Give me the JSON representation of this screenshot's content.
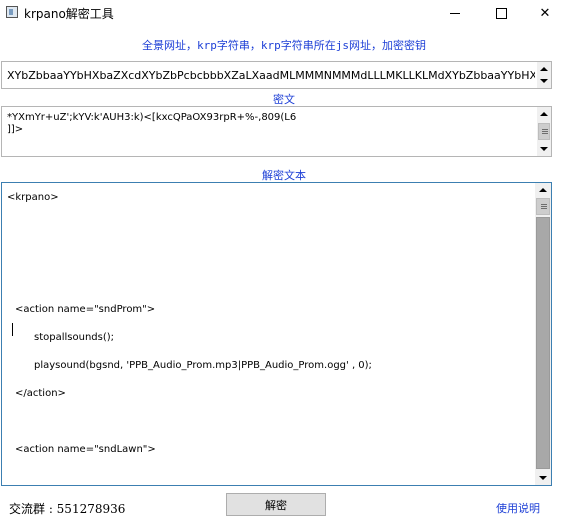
{
  "window": {
    "title": "krpano解密工具",
    "minimize_glyph": "—",
    "maximize_glyph": "☐",
    "close_glyph": "✕"
  },
  "labels": {
    "url_instructions": "全景网址，krp字符串，krp字符串所在js网址，加密密钥",
    "cipher": "密文",
    "decrypted": "解密文本"
  },
  "url_input": {
    "value": "XYbZbbaaYYbHXbaZXcdXYbZbPcbcbbbXZaLXaadMLMMMNMMMdLLLMKLLKLMdXYbZbbaaYYbHXbaZXc"
  },
  "cipher_box": {
    "value": "*YXmYr+uZ';kYV:k'AUH3:k)<[kxcQPaOX93rpR+%-,809(L6\n]]>"
  },
  "output": {
    "lines": [
      "<krpano>",
      "<action name=\"sndProm\">",
      "stopallsounds();",
      "playsound(bgsnd, 'PPB_Audio_Prom.mp3|PPB_Audio_Prom.ogg' , 0);",
      "</action>",
      "<action name=\"sndLawn\">"
    ]
  },
  "footer": {
    "group_label": "交流群 : 551278936",
    "decrypt_button": "解密",
    "help_link": "使用说明"
  }
}
